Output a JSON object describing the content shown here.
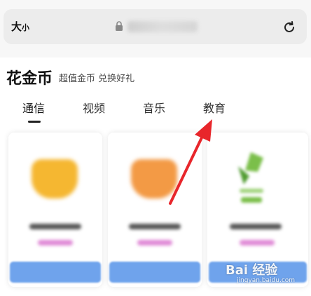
{
  "browser": {
    "text_size_big": "大",
    "text_size_small": "小",
    "lock_icon": "lock-icon",
    "reload_icon": "reload-icon"
  },
  "section": {
    "title": "花金币",
    "subtitle": "超值金币 兑换好礼"
  },
  "tabs": [
    {
      "label": "通信",
      "active": true
    },
    {
      "label": "视频",
      "active": false
    },
    {
      "label": "音乐",
      "active": false
    },
    {
      "label": "教育",
      "active": false
    }
  ],
  "cards": [
    {
      "thumb_color": "#f5b731"
    },
    {
      "thumb_color": "#f39a45"
    },
    {
      "thumb_color": "#7bbf4a"
    }
  ],
  "watermark": {
    "main": "Bai 经验",
    "sub": "jingyan.baidu.com"
  },
  "colors": {
    "arrow": "#e8262b",
    "button": "#6fa3ec",
    "price": "#e08ad6"
  }
}
